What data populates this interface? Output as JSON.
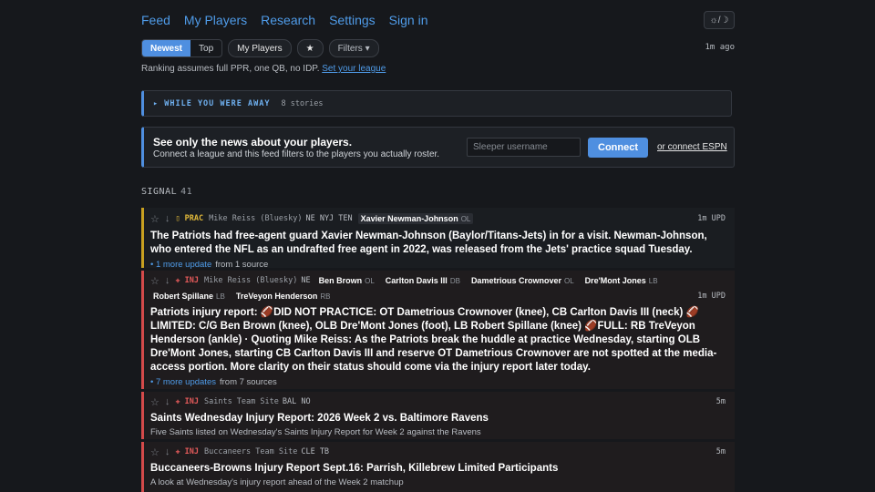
{
  "nav": {
    "feed": "Feed",
    "my_players": "My Players",
    "research": "Research",
    "settings": "Settings",
    "sign_in": "Sign in"
  },
  "theme_toggle": "☼/☽",
  "controls": {
    "newest": "Newest",
    "top": "Top",
    "my_players": "My Players",
    "star": "★",
    "filters": "Filters ▾",
    "updated": "1m ago"
  },
  "ranking": {
    "text": "Ranking assumes full PPR, one QB, no IDP.",
    "link": "Set your league"
  },
  "away": {
    "label": "▸ WHILE YOU WERE AWAY",
    "count": "8 stories"
  },
  "connect": {
    "heading": "See only the news about your players.",
    "sub": "Connect a league and this feed filters to the players you actually roster.",
    "placeholder": "Sleeper username",
    "button": "Connect",
    "espn": "or connect ESPN"
  },
  "signal": {
    "label": "SIGNAL",
    "count": "41"
  },
  "items": [
    {
      "badge": "PRAC",
      "source": "Mike Reiss (Bluesky)",
      "teams": "NE NYJ TEN",
      "players": [
        {
          "name": "Xavier Newman-Johnson",
          "pos": "OL"
        }
      ],
      "time": "1m UPD",
      "title": "The Patriots had free-agent guard Xavier Newman-Johnson (Baylor/Titans-Jets) in for a visit. Newman-Johnson, who entered the NFL as an undrafted free agent in 2022, was released from the Jets' practice squad Tuesday.",
      "updates": "• 1 more update",
      "from": "from 1 source"
    },
    {
      "badge": "INJ",
      "source": "Mike Reiss (Bluesky)",
      "teams": "NE",
      "players": [
        {
          "name": "Ben Brown",
          "pos": "OL"
        },
        {
          "name": "Carlton Davis III",
          "pos": "DB"
        },
        {
          "name": "Dametrious Crownover",
          "pos": "OL"
        },
        {
          "name": "Dre'Mont Jones",
          "pos": "LB"
        },
        {
          "name": "Robert Spillane",
          "pos": "LB"
        },
        {
          "name": "TreVeyon Henderson",
          "pos": "RB"
        }
      ],
      "time": "1m UPD",
      "title": "Patriots injury report: 🏈DID NOT PRACTICE: OT Dametrious Crownover (knee), CB Carlton Davis III (neck) 🏈LIMITED: C/G Ben Brown (knee), OLB Dre'Mont Jones (foot), LB Robert Spillane (knee) 🏈FULL: RB TreVeyon Henderson (ankle) · Quoting Mike Reiss: As the Patriots break the huddle at practice Wednesday, starting OLB Dre'Mont Jones, starting CB Carlton Davis III and reserve OT Dametrious Crownover are not spotted at the media-access portion. More clarity on their status should come via the injury report later today.",
      "updates": "• 7 more updates",
      "from": "from 7 sources"
    },
    {
      "badge": "INJ",
      "source": "Saints Team Site",
      "teams": "BAL NO",
      "time": "5m",
      "title": "Saints Wednesday Injury Report: 2026 Week 2 vs. Baltimore Ravens",
      "sub": "Five Saints listed on Wednesday's Saints Injury Report for Week 2 against the Ravens"
    },
    {
      "badge": "INJ",
      "source": "Buccaneers Team Site",
      "teams": "CLE TB",
      "time": "5m",
      "title": "Buccaneers-Browns Injury Report Sept.16: Parrish, Killebrew Limited Participants",
      "sub": "A look at Wednesday's injury report ahead of the Week 2 matchup"
    }
  ]
}
